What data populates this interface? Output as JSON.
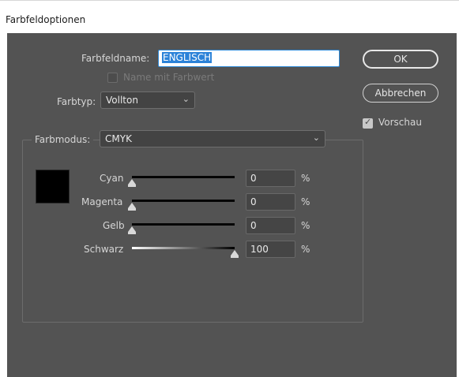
{
  "window": {
    "title": "Farbfeldoptionen"
  },
  "form": {
    "name_label": "Farbfeldname:",
    "name_value": "ENGLISCH",
    "name_with_value_label": "Name mit Farbwert",
    "name_with_value_checked": false,
    "type_label": "Farbtyp:",
    "type_value": "Vollton",
    "mode_label": "Farbmodus:",
    "mode_value": "CMYK"
  },
  "buttons": {
    "ok_label": "OK",
    "cancel_label": "Abbrechen"
  },
  "preview": {
    "label": "Vorschau",
    "checked": true
  },
  "swatch": {
    "color": "#000000"
  },
  "channels": [
    {
      "label": "Cyan",
      "value": "0",
      "unit": "%"
    },
    {
      "label": "Magenta",
      "value": "0",
      "unit": "%"
    },
    {
      "label": "Gelb",
      "value": "0",
      "unit": "%"
    },
    {
      "label": "Schwarz",
      "value": "100",
      "unit": "%"
    }
  ],
  "colors": {
    "panel_bg": "#535353",
    "accent": "#2b82d8"
  }
}
